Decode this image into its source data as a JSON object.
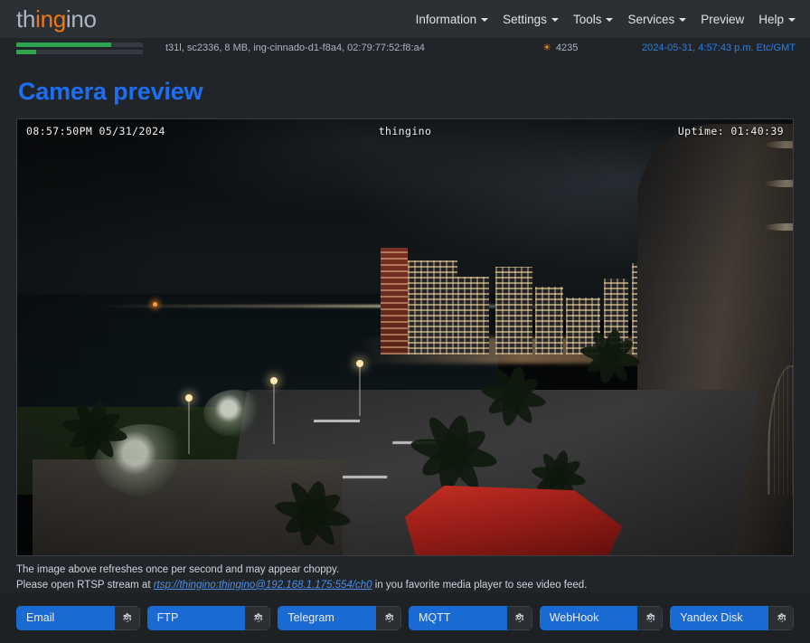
{
  "brand": {
    "prefix": "th",
    "accent": "ing",
    "suffix": "ino",
    "accent_color": "#f07814"
  },
  "nav": {
    "items": [
      {
        "label": "Information",
        "has_caret": true
      },
      {
        "label": "Settings",
        "has_caret": true
      },
      {
        "label": "Tools",
        "has_caret": true
      },
      {
        "label": "Services",
        "has_caret": true
      },
      {
        "label": "Preview",
        "has_caret": false
      },
      {
        "label": "Help",
        "has_caret": true
      }
    ]
  },
  "statusbar": {
    "bars": [
      {
        "name": "memory",
        "percent": 75
      },
      {
        "name": "storage",
        "percent": 16
      }
    ],
    "system_info": "t31l, sc2336, 8 MB, ing-cinnado-d1-f8a4, 02:79:77:52:f8:a4",
    "light_icon": "sun-icon",
    "light_value": "4235",
    "datetime": "2024-05-31, 4:57:43 p.m. Etc/GMT",
    "datetime_color": "#2a7fe8"
  },
  "page": {
    "title": "Camera preview",
    "title_color": "#1d6ff2"
  },
  "video": {
    "osd_timestamp": "08:57:50PM 05/31/2024",
    "osd_center": "thingino",
    "osd_uptime": "Uptime: 01:40:39",
    "scene_description": "Night cityscape overlooking a beachfront road with palm trees, lit high-rise towers and a red awning"
  },
  "notes": {
    "line1": "The image above refreshes once per second and may appear choppy.",
    "line2_prefix": "Please open RTSP stream at ",
    "rtsp_url": "rtsp://thingino:thingino@192.168.1.175:554/ch0",
    "line2_suffix": " in you favorite media player to see video feed."
  },
  "actions": {
    "cog_icon": "gear-icon",
    "items": [
      {
        "label": "Email"
      },
      {
        "label": "FTP"
      },
      {
        "label": "Telegram"
      },
      {
        "label": "MQTT"
      },
      {
        "label": "WebHook"
      },
      {
        "label": "Yandex Disk"
      }
    ]
  }
}
